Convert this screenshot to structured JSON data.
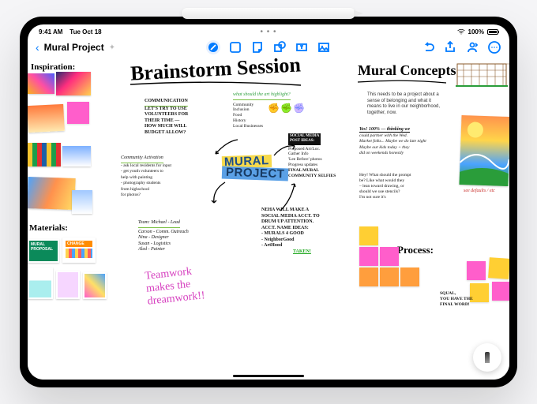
{
  "status": {
    "time": "9:41 AM",
    "date": "Tue Oct 18",
    "battery": "100%"
  },
  "toolbar": {
    "doc_title": "Mural Project",
    "tools": [
      "draw",
      "text",
      "sticky",
      "shape",
      "media",
      "photo"
    ]
  },
  "canvas": {
    "headings": {
      "brainstorm": "Brainstorm Session",
      "concepts": "Mural Concepts",
      "inspiration": "Inspiration:",
      "materials": "Materials:",
      "process": "Process:"
    },
    "communication": {
      "label": "COMMUNICATION",
      "body": "LET'S TRY TO USE\nVOLUNTEERS FOR\nTHEIR TIME —\nHOW MUCH WILL\nBUDGET ALLOW?"
    },
    "highlight": {
      "q": "what should the art highlight?",
      "items": [
        "Community",
        "Inclusion",
        "Food",
        "History",
        "Local Businesses"
      ]
    },
    "activation": {
      "label": "Community Activation",
      "body": "- ask local residents for input\n- get youth volunteers to\n  help with painting\n- photography students\n  from highschool\n  for photos?"
    },
    "team": {
      "label": "Team: Michael - Lead",
      "lines": [
        "Carson - Comm. Outreach",
        "Nina - Designer",
        "Susan - Logistics",
        "Aled - Painter"
      ]
    },
    "mural_chip": {
      "l1": "MURAL",
      "l2": "PROJECT"
    },
    "socialpost": {
      "label": "SOCIAL MEDIA\nPOST IDEAS:",
      "items": [
        "Proposed Art/Loc.",
        "Gather Info",
        "'Lee Before' photos",
        "Progress updates",
        "FINAL MURAL",
        "COMMUNITY SELFIES"
      ]
    },
    "neha": "NEHA WILL MAKE A\nSOCIAL MEDIA ACCT. TO\nDRUM UP ATTENTION.\nACCT. NAME IDEAS:\n- MURALS 4 GOOD\n- NeighborGood\n- ArtHood",
    "neha_tag": "TAKEN!",
    "teamwork": "Teamwork\nmakes the\ndreamwork!!",
    "concepts_intro": "This needs to be a project about a\nsense of belonging and what it\nmeans to live in our neighborhood,\ntogether, now.",
    "yes": {
      "label": "Yes! 100% — thinking we",
      "body": "could partner with the Wed.\nMarket folks... Maybe we do late night\nMaybe our kids today + they\ndid on weekends honestly"
    },
    "prompt": "Hey! What should the prompt\nbe? Like what would they\n– lean toward drawing, or\nshould we use stencils?\nI'm not sure it's",
    "defaults": "see defaults / etc",
    "squal": "SQUAL,\nYOU HAVE THE\nFINAL WORD!",
    "book_proposal": "MURAL\nPROPOSAL",
    "book_change": "CHANGE"
  }
}
